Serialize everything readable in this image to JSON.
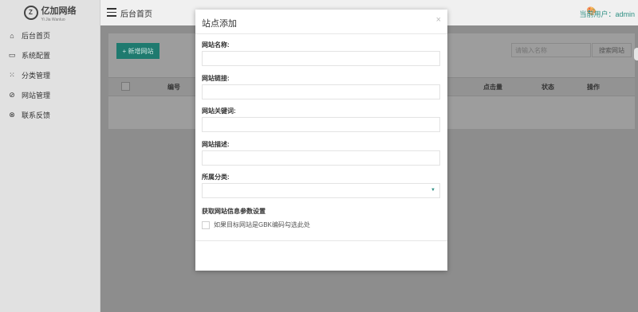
{
  "app": {
    "logo_text": "亿加网络",
    "logo_sub": "Yi Jia Wanluo",
    "logo_glyph": "Z"
  },
  "sidebar": {
    "items": [
      {
        "label": "后台首页",
        "icon": "home-icon",
        "glyph": "⌂"
      },
      {
        "label": "系统配置",
        "icon": "monitor-icon",
        "glyph": "▭"
      },
      {
        "label": "分类管理",
        "icon": "grid-icon",
        "glyph": "⁙"
      },
      {
        "label": "网站管理",
        "icon": "compass-icon",
        "glyph": "⊘"
      },
      {
        "label": "联系反馈",
        "icon": "settings-icon",
        "glyph": "⊗"
      }
    ]
  },
  "header": {
    "title": "后台首页",
    "user_text": "当前用户：admin"
  },
  "toolbar": {
    "add_label": "+ 新增网站",
    "search_placeholder": "请输入名称",
    "search_label": "搜索网站"
  },
  "table": {
    "columns": [
      "编号",
      "点击量",
      "状态",
      "操作"
    ]
  },
  "modal": {
    "title": "站点添加",
    "close": "×",
    "fields": [
      {
        "label": "网站名称:",
        "value": ""
      },
      {
        "label": "网站链接:",
        "value": ""
      },
      {
        "label": "网站关键词:",
        "value": ""
      },
      {
        "label": "网站描述:",
        "value": ""
      },
      {
        "label": "所属分类:",
        "value": ""
      }
    ],
    "section_title": "获取网站信息参数设置",
    "gbk_label": "如果目标网站是GBK编码勾选此处"
  },
  "colors": {
    "accent": "#2e8f83"
  }
}
